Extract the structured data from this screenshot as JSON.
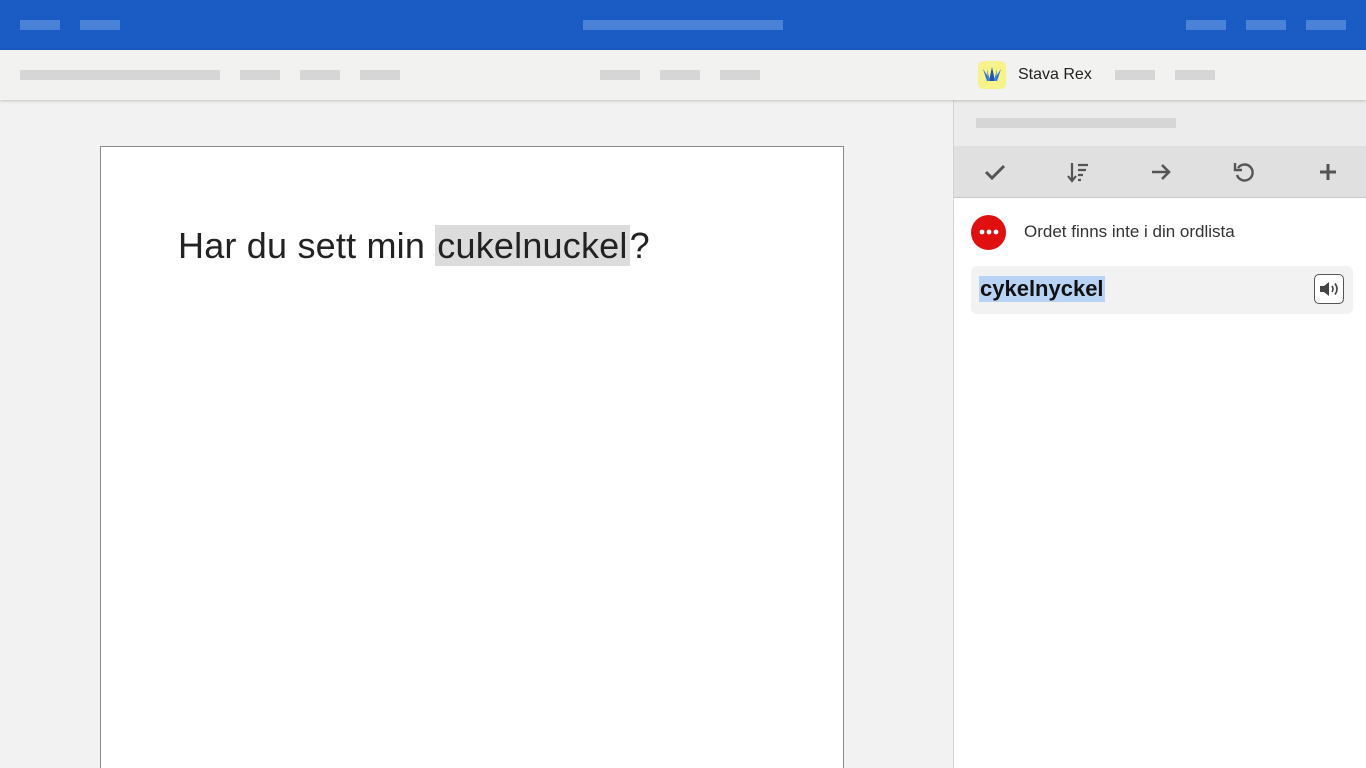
{
  "toolbar": {
    "brand_name": "Stava Rex",
    "brand_logo_icon": "crown-icon"
  },
  "document": {
    "text_before": "Har du sett min ",
    "misspelled_word": "cukelnuckel",
    "text_after": "?"
  },
  "panel": {
    "tools": [
      "check-icon",
      "sort-icon",
      "arrow-right-icon",
      "undo-icon",
      "plus-icon"
    ],
    "message_icon": "error-dots-icon",
    "message": "Ordet finns inte i din ordlista",
    "suggestion": "cykelnyckel",
    "speak_icon": "speaker-icon"
  },
  "colors": {
    "topbar": "#1a5bc4",
    "error": "#e01010",
    "selection": "#b9d3f5",
    "highlight": "#dcdcdc"
  }
}
